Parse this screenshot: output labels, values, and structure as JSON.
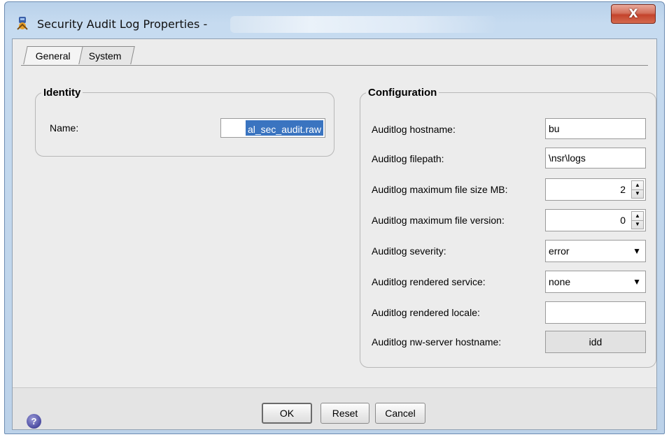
{
  "window": {
    "title": "Security Audit Log Properties -",
    "close_glyph": "X"
  },
  "tabs": [
    {
      "label": "General",
      "selected": true
    },
    {
      "label": "System",
      "selected": false
    }
  ],
  "identity": {
    "group_title": "Identity",
    "name_label": "Name:",
    "name_value": "al_sec_audit.raw"
  },
  "configuration": {
    "group_title": "Configuration",
    "hostname_label": "Auditlog hostname:",
    "hostname_value": "bu",
    "filepath_label": "Auditlog filepath:",
    "filepath_value": "\\nsr\\logs",
    "max_size_label": "Auditlog maximum file size MB:",
    "max_size_value": "2",
    "max_version_label": "Auditlog maximum file version:",
    "max_version_value": "0",
    "severity_label": "Auditlog severity:",
    "severity_value": "error",
    "rendered_service_label": "Auditlog rendered service:",
    "rendered_service_value": "none",
    "rendered_locale_label": "Auditlog rendered locale:",
    "rendered_locale_value": "",
    "nw_server_label": "Auditlog nw-server hostname:",
    "nw_server_value": "idd"
  },
  "footer": {
    "help_glyph": "?",
    "ok_label": "OK",
    "reset_label": "Reset",
    "cancel_label": "Cancel"
  },
  "icons": {
    "app_icon": "security-audit-app-icon",
    "close": "close-icon",
    "spinner_up": "spinner-up-arrow",
    "spinner_down": "spinner-down-arrow",
    "dropdown": "chevron-down-icon",
    "help": "help-icon"
  },
  "colors": {
    "title_bar": "#c6dbf0",
    "close_button": "#c4432c",
    "selection": "#3a74c0",
    "panel": "#ececec"
  }
}
